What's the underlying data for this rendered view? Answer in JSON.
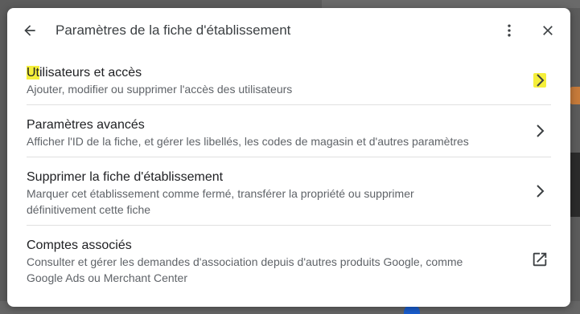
{
  "dialog": {
    "title": "Paramètres de la fiche d'établissement",
    "back_icon": "arrow-left-icon",
    "more_icon": "more-vert-icon",
    "close_icon": "close-icon"
  },
  "rows": [
    {
      "title_first": "Ut",
      "title_rest": "ilisateurs et accès",
      "subtitle": "Ajouter, modifier ou supprimer l'accès des utilisateurs",
      "action_icon": "chevron-right-icon",
      "highlight_color": "#f5ef3a"
    },
    {
      "title": "Paramètres avancés",
      "subtitle": "Afficher l'ID de la fiche, et gérer les libellés, les codes de magasin et d'autres paramètres",
      "action_icon": "chevron-right-icon"
    },
    {
      "title": "Supprimer la fiche d'établissement",
      "subtitle": "Marquer cet établissement comme fermé, transférer la propriété ou supprimer définitivement cette fiche",
      "action_icon": "chevron-right-icon"
    },
    {
      "title": "Comptes associés",
      "subtitle": "Consulter et gérer les demandes d'association depuis d'autres produits Google, comme Google Ads ou Merchant Center",
      "action_icon": "open-in-new-icon"
    }
  ],
  "colors": {
    "accent_highlight": "#f5ef3a",
    "title_text": "#202124",
    "secondary_text": "#5f6368"
  }
}
